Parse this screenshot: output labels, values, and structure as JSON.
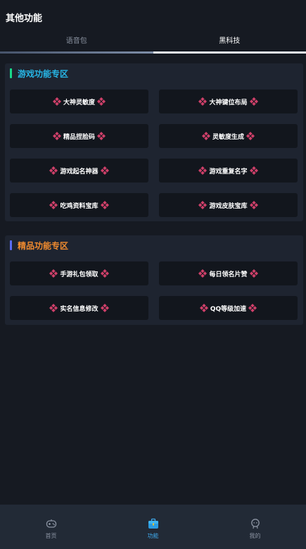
{
  "header": {
    "title": "其他功能"
  },
  "tabs": [
    {
      "label": "语音包",
      "active": false
    },
    {
      "label": "黑科技",
      "active": true
    }
  ],
  "sections": [
    {
      "title": "游戏功能专区",
      "accent_bar": "#19d98a",
      "title_color": "#27b6e6",
      "buttons": [
        "大神灵敏度",
        "大神键位布局",
        "精品捏脸码",
        "灵敏度生成",
        "游戏起名神器",
        "游戏重复名字",
        "吃鸡资料宝库",
        "游戏皮肤宝库"
      ]
    },
    {
      "title": "精品功能专区",
      "accent_bar": "#5a6cf5",
      "title_color": "#f08b2f",
      "buttons": [
        "手游礼包领取",
        "每日领名片赞",
        "实名信息修改",
        "QQ等级加速"
      ]
    }
  ],
  "button_icon": "pink-diamond-icon",
  "bottom_nav": [
    {
      "label": "首页",
      "icon": "gamepad-icon",
      "active": false
    },
    {
      "label": "功能",
      "icon": "toolbox-icon",
      "active": true
    },
    {
      "label": "我的",
      "icon": "profile-icon",
      "active": false
    }
  ],
  "colors": {
    "background": "#161a22",
    "card": "#1e2430",
    "button": "#12161d",
    "diamond": "#d0406a",
    "nav_active": "#3fa8ea"
  }
}
